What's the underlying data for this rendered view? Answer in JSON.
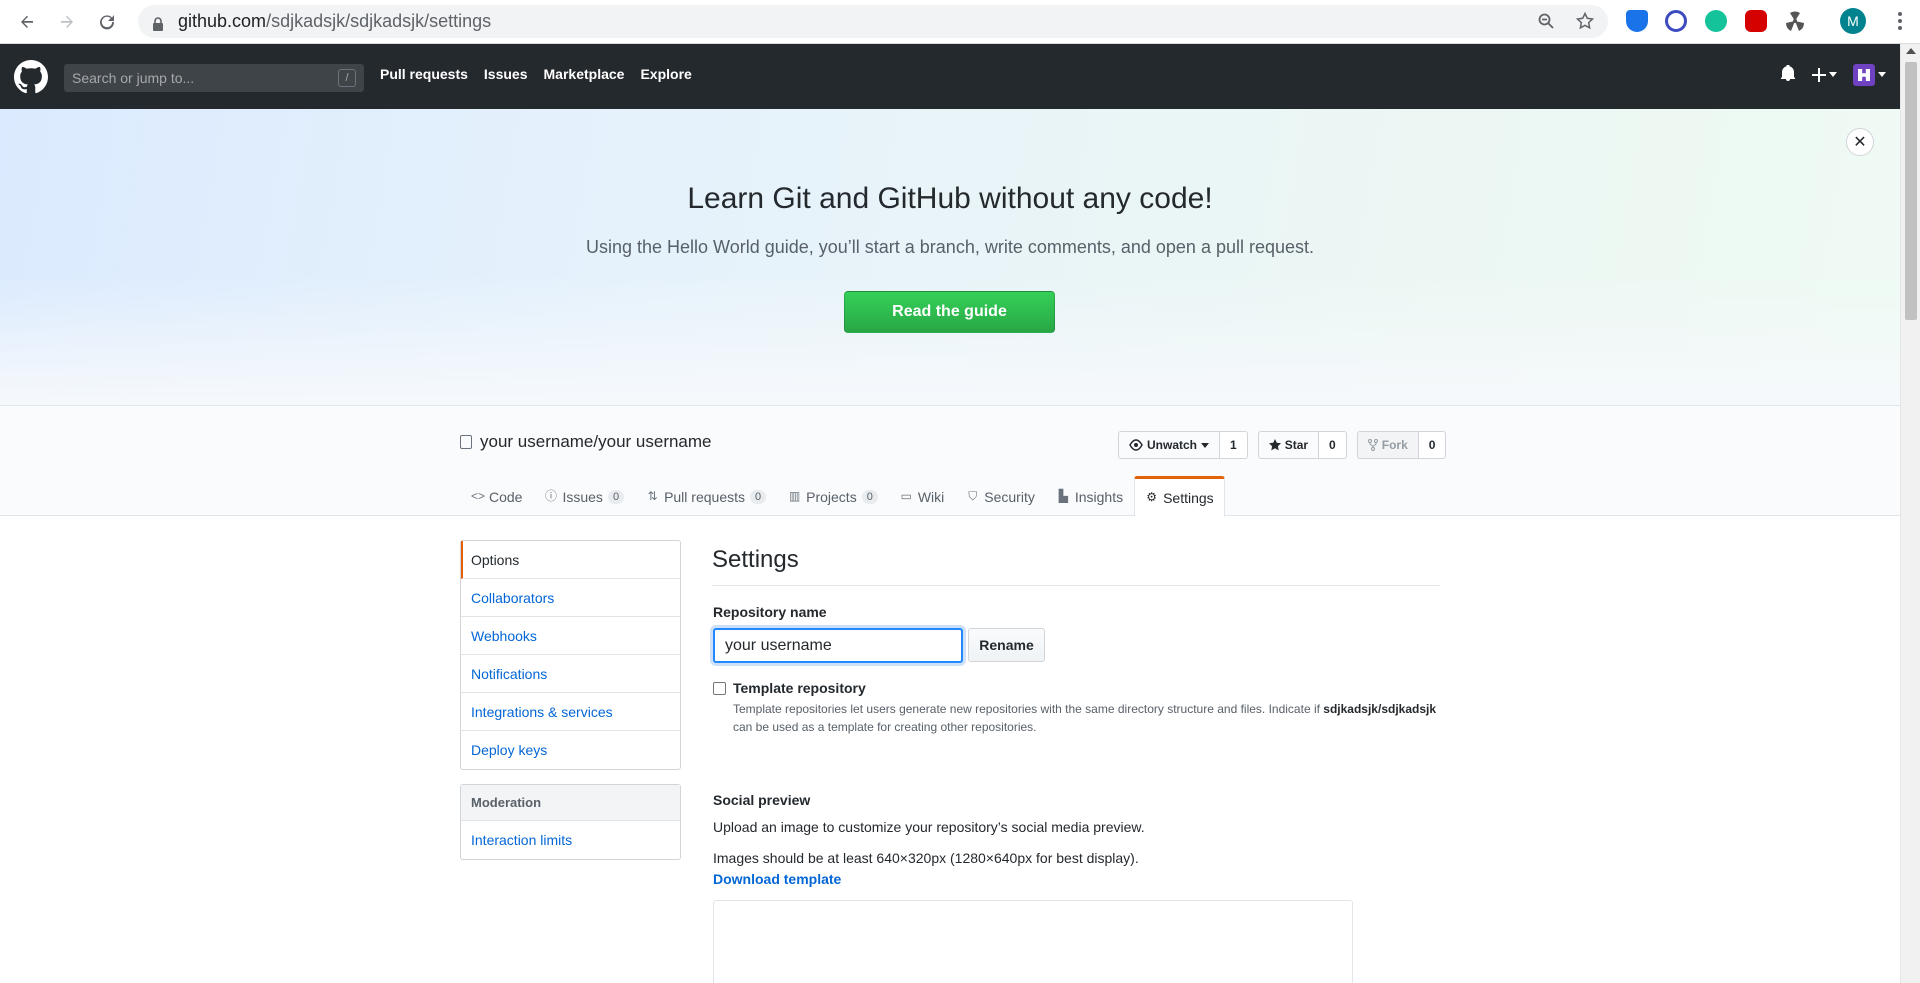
{
  "browser": {
    "url_host": "github.com",
    "url_path": "/sdjkadsjk/sdjkadsjk/settings",
    "profile_initial": "M"
  },
  "header": {
    "search_placeholder": "Search or jump to...",
    "search_shortcut": "/",
    "nav": [
      "Pull requests",
      "Issues",
      "Marketplace",
      "Explore"
    ]
  },
  "banner": {
    "title": "Learn Git and GitHub without any code!",
    "subtitle": "Using the Hello World guide, you’ll start a branch, write comments, and open a pull request.",
    "button": "Read the guide",
    "close": "✕"
  },
  "repo": {
    "title": "your username/your username",
    "unwatch_label": "Unwatch",
    "watch_count": "1",
    "star_label": "Star",
    "star_count": "0",
    "fork_label": "Fork",
    "fork_count": "0",
    "tabs": [
      {
        "label": "Code",
        "count": ""
      },
      {
        "label": "Issues",
        "count": "0"
      },
      {
        "label": "Pull requests",
        "count": "0"
      },
      {
        "label": "Projects",
        "count": "0"
      },
      {
        "label": "Wiki",
        "count": ""
      },
      {
        "label": "Security",
        "count": ""
      },
      {
        "label": "Insights",
        "count": ""
      },
      {
        "label": "Settings",
        "count": ""
      }
    ]
  },
  "menu": {
    "items": [
      "Options",
      "Collaborators",
      "Webhooks",
      "Notifications",
      "Integrations & services",
      "Deploy keys"
    ],
    "moderation_heading": "Moderation",
    "moderation_items": [
      "Interaction limits"
    ]
  },
  "settings": {
    "title": "Settings",
    "repo_name_label": "Repository name",
    "repo_name_value": "your username",
    "rename_button": "Rename",
    "template_label": "Template repository",
    "template_help_1": "Template repositories let users generate new repositories with the same directory structure and files. Indicate if ",
    "template_help_repo": "sdjkadsjk/sdjkadsjk",
    "template_help_2": " can be used as a template for creating other repositories.",
    "social_preview_label": "Social preview",
    "social_preview_text": "Upload an image to customize your repository’s social media preview.",
    "social_preview_size": "Images should be at least 640×320px (1280×640px for best display).",
    "download_template": "Download template"
  }
}
